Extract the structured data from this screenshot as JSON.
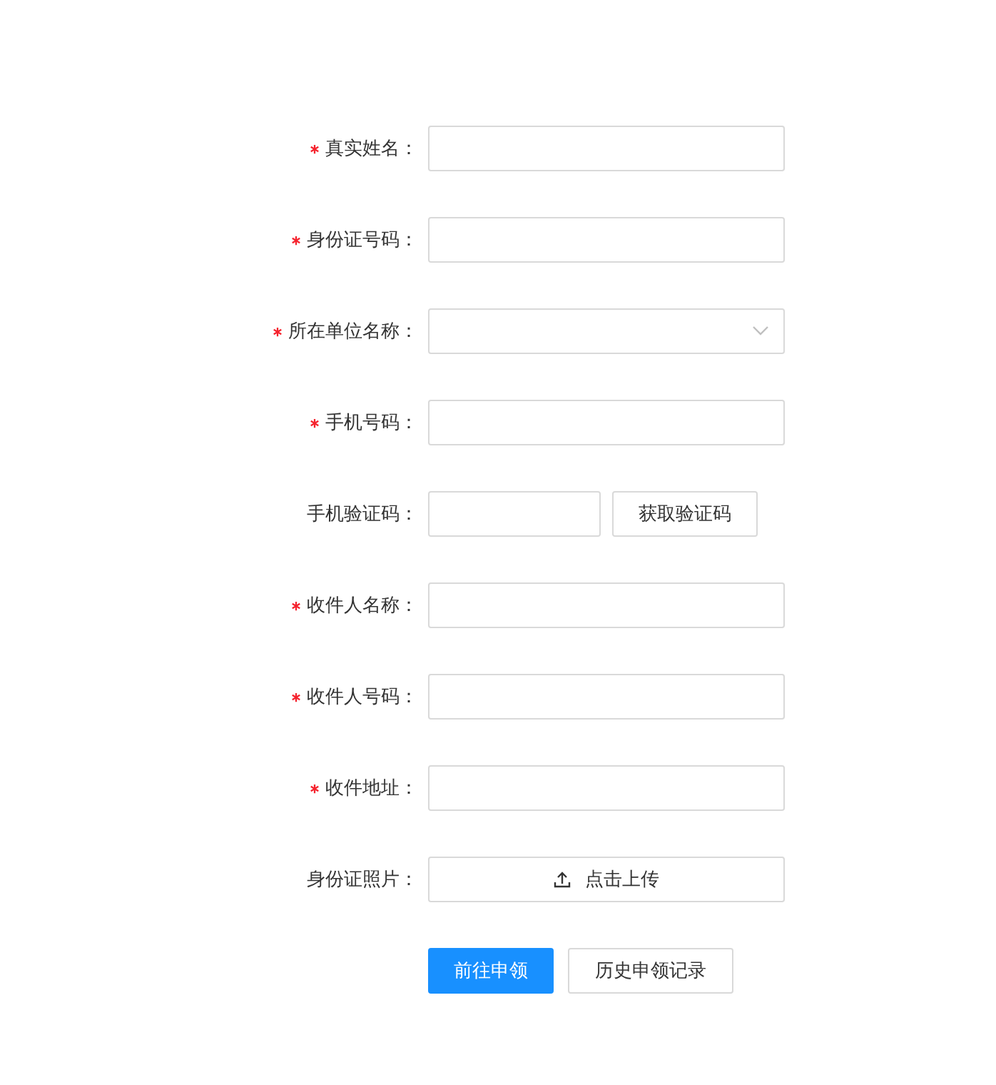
{
  "form": {
    "fields": [
      {
        "kind": "text",
        "label": "真实姓名：",
        "required": true
      },
      {
        "kind": "text",
        "label": "身份证号码：",
        "required": true
      },
      {
        "kind": "select",
        "label": "所在单位名称：",
        "required": true
      },
      {
        "kind": "text",
        "label": "手机号码：",
        "required": true
      },
      {
        "kind": "sms",
        "label": "手机验证码：",
        "required": false,
        "button": "获取验证码"
      },
      {
        "kind": "text",
        "label": "收件人名称：",
        "required": true
      },
      {
        "kind": "text",
        "label": "收件人号码：",
        "required": true
      },
      {
        "kind": "text",
        "label": "收件地址：",
        "required": true
      },
      {
        "kind": "upload",
        "label": "身份证照片：",
        "required": false,
        "button": "点击上传"
      }
    ],
    "buttons": [
      {
        "label": "前往申领",
        "primary": true
      },
      {
        "label": "历史申领记录",
        "primary": false
      }
    ]
  }
}
